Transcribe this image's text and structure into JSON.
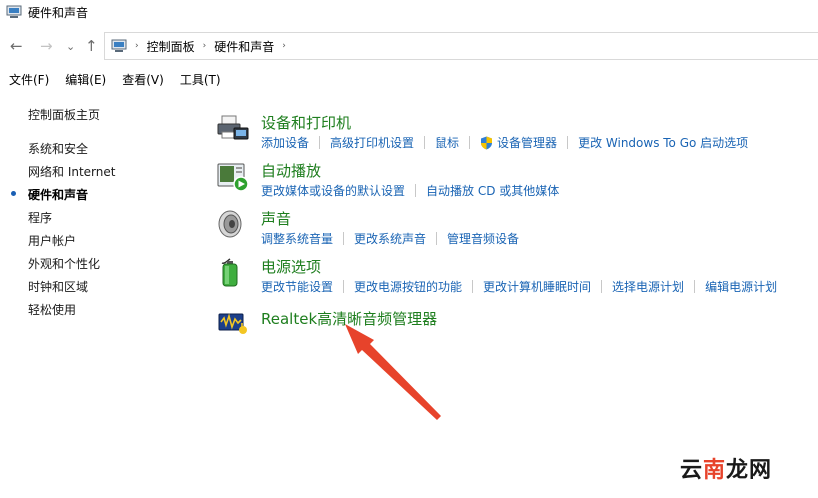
{
  "window": {
    "title": "硬件和声音"
  },
  "nav": {
    "back_glyph": "←",
    "forward_glyph": "→",
    "recent_glyph": "⌄",
    "up_glyph": "↑"
  },
  "breadcrumb": {
    "sep": "›",
    "items": [
      "控制面板",
      "硬件和声音"
    ]
  },
  "menu": [
    "文件(F)",
    "编辑(E)",
    "查看(V)",
    "工具(T)"
  ],
  "sidebar": {
    "home": "控制面板主页",
    "items": [
      {
        "label": "系统和安全",
        "current": false
      },
      {
        "label": "网络和 Internet",
        "current": false
      },
      {
        "label": "硬件和声音",
        "current": true
      },
      {
        "label": "程序",
        "current": false
      },
      {
        "label": "用户帐户",
        "current": false
      },
      {
        "label": "外观和个性化",
        "current": false
      },
      {
        "label": "时钟和区域",
        "current": false
      },
      {
        "label": "轻松使用",
        "current": false
      }
    ]
  },
  "categories": [
    {
      "title": "设备和打印机",
      "icon": "printer-icon",
      "links": [
        "添加设备",
        "高级打印机设置",
        "鼠标",
        "设备管理器",
        "更改 Windows To Go 启动选项"
      ]
    },
    {
      "title": "自动播放",
      "icon": "autoplay-icon",
      "links": [
        "更改媒体或设备的默认设置",
        "自动播放 CD 或其他媒体"
      ]
    },
    {
      "title": "声音",
      "icon": "speaker-icon",
      "links": [
        "调整系统音量",
        "更改系统声音",
        "管理音频设备"
      ]
    },
    {
      "title": "电源选项",
      "icon": "battery-icon",
      "links": [
        "更改节能设置",
        "更改电源按钮的功能",
        "更改计算机睡眠时间",
        "选择电源计划",
        "编辑电源计划"
      ]
    },
    {
      "title": "Realtek高清晰音频管理器",
      "icon": "realtek-audio-icon",
      "links": []
    }
  ],
  "watermark": {
    "part1": "云",
    "part2": "南",
    "part3": "龙网"
  },
  "colors": {
    "category_title": "#1e7e1e",
    "link": "#1a64b4",
    "arrow": "#e7432b"
  }
}
